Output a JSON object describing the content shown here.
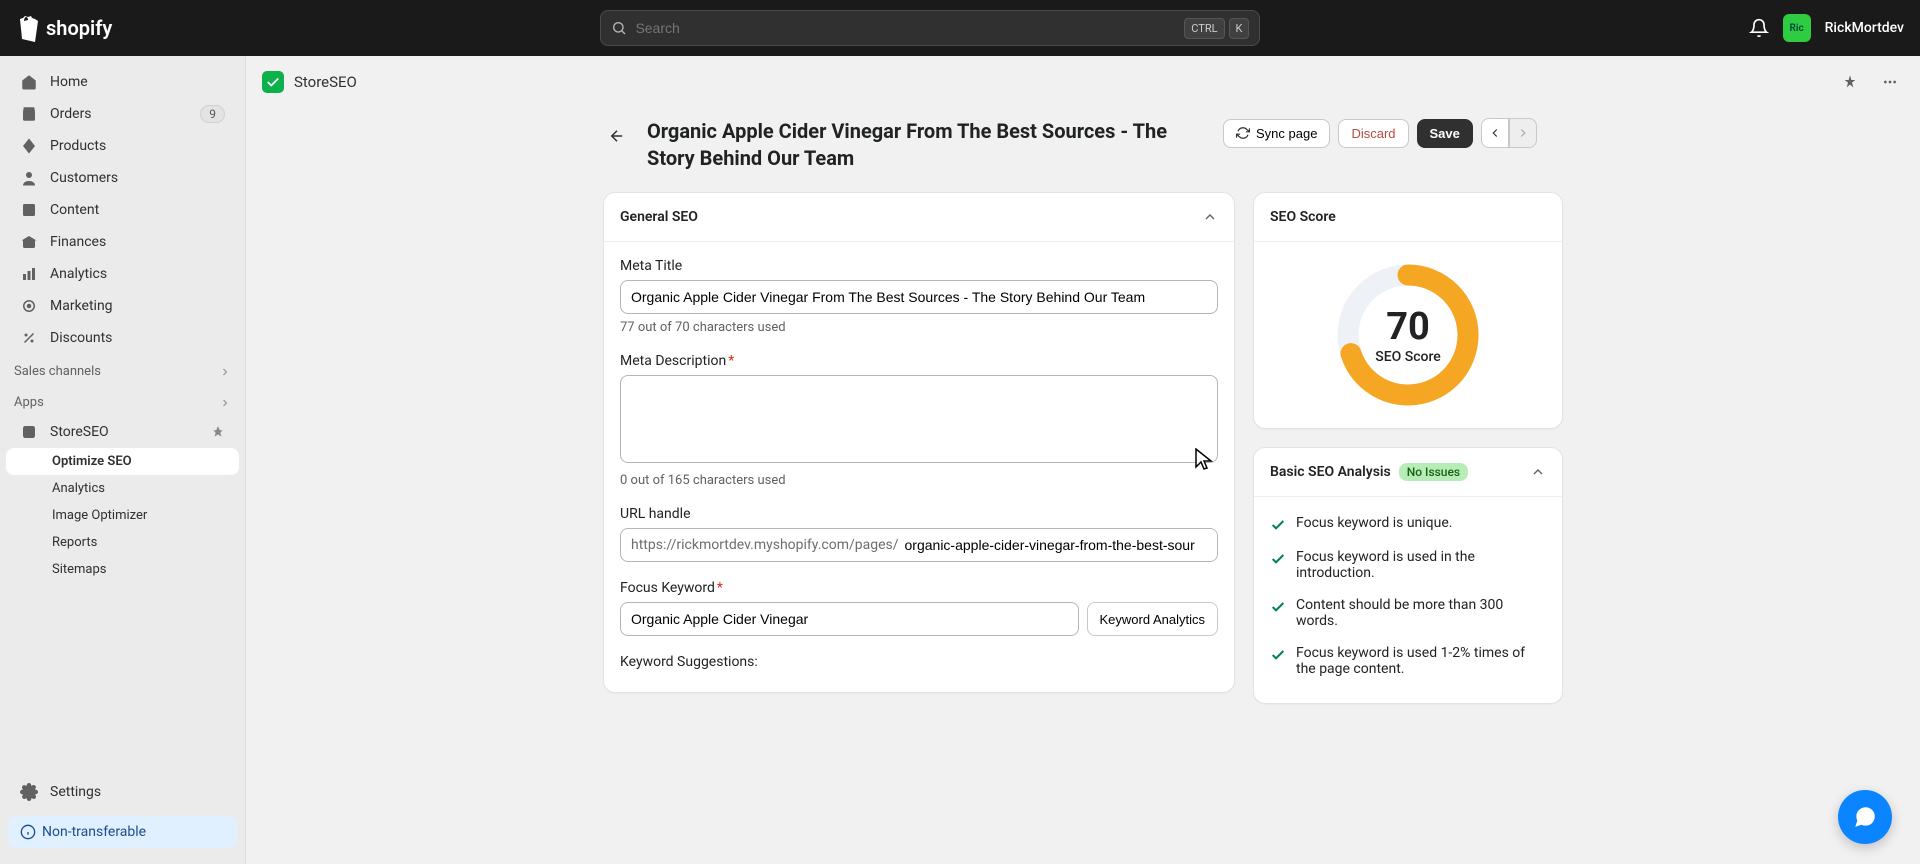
{
  "topbar": {
    "brand": "shopify",
    "search_placeholder": "Search",
    "kbd_ctrl": "CTRL",
    "kbd_k": "K",
    "avatar_initials": "Ric",
    "username": "RickMortdev"
  },
  "sidebar": {
    "items": [
      {
        "label": "Home"
      },
      {
        "label": "Orders",
        "badge": "9"
      },
      {
        "label": "Products"
      },
      {
        "label": "Customers"
      },
      {
        "label": "Content"
      },
      {
        "label": "Finances"
      },
      {
        "label": "Analytics"
      },
      {
        "label": "Marketing"
      },
      {
        "label": "Discounts"
      }
    ],
    "section_sales": "Sales channels",
    "section_apps": "Apps",
    "apps": {
      "storeseo": "StoreSEO",
      "sub": [
        {
          "label": "Optimize SEO"
        },
        {
          "label": "Analytics"
        },
        {
          "label": "Image Optimizer"
        },
        {
          "label": "Reports"
        },
        {
          "label": "Sitemaps"
        }
      ]
    },
    "settings": "Settings",
    "nontransferable": "Non-transferable"
  },
  "page": {
    "app_name": "StoreSEO",
    "title": "Organic Apple Cider Vinegar From The Best Sources - The Story Behind Our Team",
    "sync": "Sync page",
    "discard": "Discard",
    "save": "Save"
  },
  "form": {
    "card_title": "General SEO",
    "meta_title_label": "Meta Title",
    "meta_title_value": "Organic Apple Cider Vinegar From The Best Sources - The Story Behind Our Team",
    "meta_title_helper": "77 out of 70 characters used",
    "meta_desc_label": "Meta Description",
    "meta_desc_value": "",
    "meta_desc_helper": "0 out of 165 characters used",
    "url_label": "URL handle",
    "url_prefix": "https://rickmortdev.myshopify.com/pages/",
    "url_value": "organic-apple-cider-vinegar-from-the-best-sour",
    "focus_label": "Focus Keyword",
    "focus_value": "Organic Apple Cider Vinegar",
    "kw_analytics": "Keyword Analytics",
    "kw_suggestions": "Keyword Suggestions:"
  },
  "score": {
    "card_title": "SEO Score",
    "value": "70",
    "label": "SEO Score",
    "percent": 70,
    "color": "#f5a623"
  },
  "analysis": {
    "title": "Basic SEO Analysis",
    "status": "No Issues",
    "items": [
      "Focus keyword is unique.",
      "Focus keyword is used in the introduction.",
      "Content should be more than 300 words.",
      "Focus keyword is used 1-2% times of the page content."
    ]
  }
}
